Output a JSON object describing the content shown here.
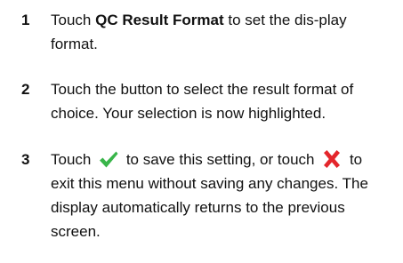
{
  "steps": [
    {
      "number": "1",
      "before": "Touch ",
      "bold": "QC Result Format",
      "after": " to set the dis-play format."
    },
    {
      "number": "2",
      "text": "Touch the button to select the result format of choice. Your selection is now highlighted."
    },
    {
      "number": "3",
      "before": "Touch ",
      "middle": " to save this setting, or touch ",
      "after": " to exit this menu without saving any changes. The display automatically returns to the previous screen."
    }
  ],
  "icons": {
    "confirm": {
      "name": "checkmark-icon",
      "color": "#39b54a"
    },
    "cancel": {
      "name": "cross-icon",
      "color": "#e4262c"
    }
  }
}
